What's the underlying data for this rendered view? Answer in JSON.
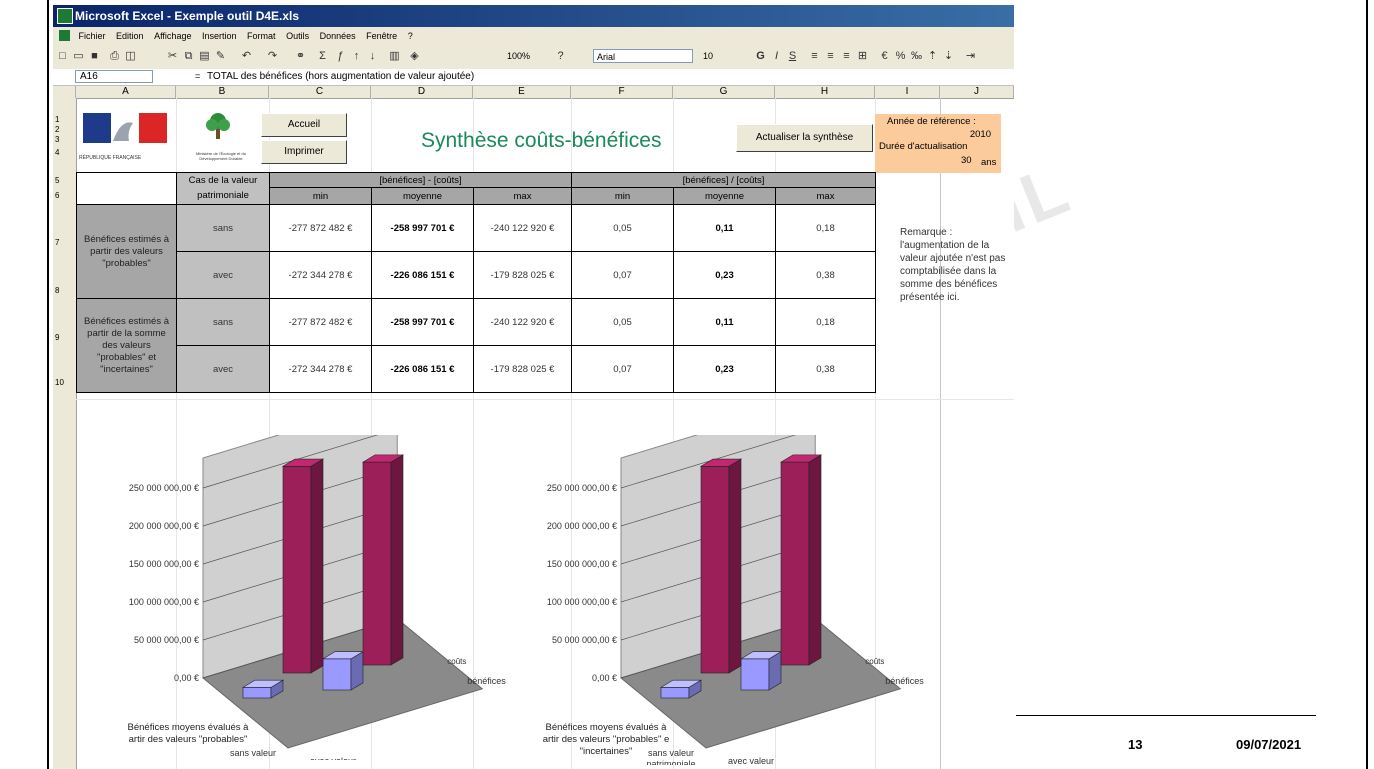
{
  "window": {
    "title": "Microsoft Excel - Exemple outil D4E.xls"
  },
  "menu": [
    "Fichier",
    "Edition",
    "Affichage",
    "Insertion",
    "Format",
    "Outils",
    "Données",
    "Fenêtre",
    "?"
  ],
  "toolbar": {
    "zoom": "100%",
    "font": "Arial",
    "size": "10"
  },
  "formula_bar": {
    "cell": "A16",
    "content": "TOTAL des bénéfices (hors augmentation de valeur ajoutée)"
  },
  "columns": [
    "A",
    "B",
    "C",
    "D",
    "E",
    "F",
    "G",
    "H",
    "I",
    "J"
  ],
  "rows": [
    "1",
    "2",
    "3",
    "4",
    "5",
    "6",
    "7",
    "8",
    "9",
    "10"
  ],
  "logos": {
    "republique": "RÉPUBLIQUE FRANÇAISE",
    "ministry": "Ministère de l'Écologie et du Développement Durable"
  },
  "buttons": {
    "accueil": "Accueil",
    "imprimer": "Imprimer",
    "actualiser": "Actualiser la synthèse"
  },
  "sheet_title": "Synthèse coûts-bénéfices",
  "reference": {
    "year_label": "Année de référence :",
    "year_value": "2010",
    "duration_label": "Durée d'actualisation",
    "duration_value": "30",
    "duration_unit": "ans"
  },
  "table": {
    "case_header_1": "Cas de la valeur",
    "case_header_2": "patrimoniale",
    "diff_header": "[bénéfices] - [coûts]",
    "ratio_header": "[bénéfices] / [coûts]",
    "sub_headers": [
      "min",
      "moyenne",
      "max",
      "min",
      "moyenne",
      "max"
    ],
    "group1_label": "Bénéfices estimés à partir des valeurs \"probables\"",
    "group2_label": "Bénéfices estimés à partir de la somme des valeurs \"probables\" et \"incertaines\"",
    "rows": [
      {
        "case": "sans",
        "vals": [
          "-277 872 482 €",
          "-258 997 701 €",
          "-240 122 920 €",
          "0,05",
          "0,11",
          "0,18"
        ]
      },
      {
        "case": "avec",
        "vals": [
          "-272 344 278 €",
          "-226 086 151 €",
          "-179 828 025 €",
          "0,07",
          "0,23",
          "0,38"
        ]
      },
      {
        "case": "sans",
        "vals": [
          "-277 872 482 €",
          "-258 997 701 €",
          "-240 122 920 €",
          "0,05",
          "0,11",
          "0,18"
        ]
      },
      {
        "case": "avec",
        "vals": [
          "-272 344 278 €",
          "-226 086 151 €",
          "-179 828 025 €",
          "0,07",
          "0,23",
          "0,38"
        ]
      }
    ]
  },
  "remark": "Remarque : l'augmentation de la valeur ajoutée n'est pas comptabilisée dans la somme des bénéfices présentée ici.",
  "chart_data": [
    {
      "type": "bar",
      "title": "Bénéfices moyens évalués à partir des valeurs \"probables\"",
      "categories": [
        "sans valeur patrimoniale",
        "avec valeur patrimoniale"
      ],
      "series": [
        {
          "name": "bénéfices",
          "values": [
            14000000,
            41000000
          ]
        },
        {
          "name": "coûts",
          "values": [
            272000000,
            267000000
          ]
        }
      ],
      "tick_labels": [
        "0,00 €",
        "50 000 000,00 €",
        "100 000 000,00 €",
        "150 000 000,00 €",
        "200 000 000,00 €",
        "250 000 000,00 €"
      ],
      "ylim": [
        0,
        250000000
      ]
    },
    {
      "type": "bar",
      "title": "Bénéfices moyens évalués à partir des valeurs \"probables\" et \"incertaines\"",
      "categories": [
        "sans valeur patrimoniale",
        "avec valeur patrimoniale"
      ],
      "series": [
        {
          "name": "bénéfices",
          "values": [
            14000000,
            41000000
          ]
        },
        {
          "name": "coûts",
          "values": [
            272000000,
            267000000
          ]
        }
      ],
      "tick_labels": [
        "0,00 €",
        "50 000 000,00 €",
        "100 000 000,00 €",
        "150 000 000,00 €",
        "200 000 000,00 €",
        "250 000 000,00 €"
      ],
      "ylim": [
        0,
        250000000
      ]
    }
  ],
  "colors": {
    "cost_bar": "#9c1f5a",
    "benefit_bar": "#9999ff",
    "title_green": "#1a8a5a",
    "ref_bg": "#fbcb9c",
    "grey": "#a6a6a6"
  },
  "footer": {
    "page": "13",
    "date": "09/07/2021"
  }
}
